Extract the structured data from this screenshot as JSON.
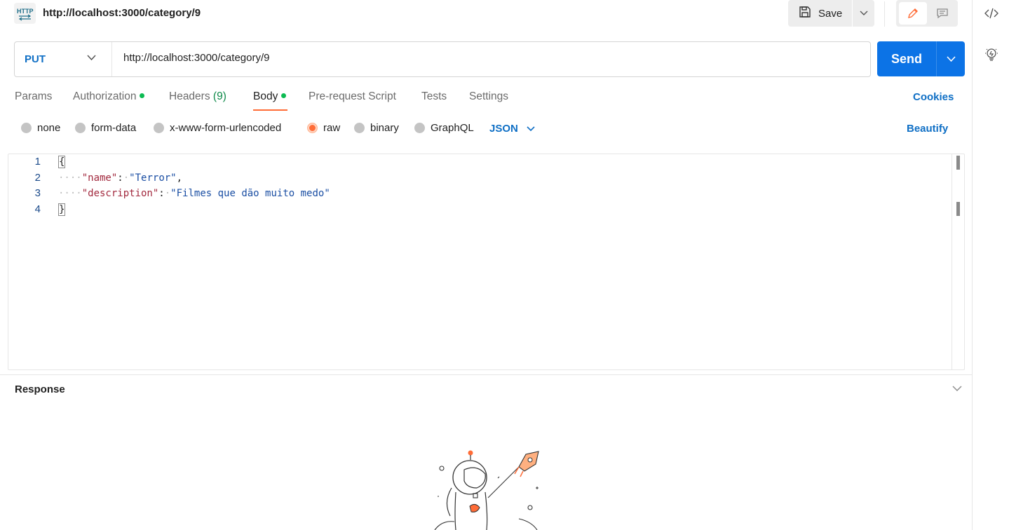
{
  "header": {
    "badge_text": "HTTP",
    "title": "http://localhost:3000/category/9",
    "save_label": "Save"
  },
  "request": {
    "method": "PUT",
    "url": "http://localhost:3000/category/9",
    "send_label": "Send"
  },
  "tabs": [
    {
      "label": "Params"
    },
    {
      "label": "Authorization"
    },
    {
      "label": "Headers",
      "count": "(9)"
    },
    {
      "label": "Body"
    },
    {
      "label": "Pre-request Script"
    },
    {
      "label": "Tests"
    },
    {
      "label": "Settings"
    }
  ],
  "active_tab": "Body",
  "cookies_label": "Cookies",
  "body_types": [
    "none",
    "form-data",
    "x-www-form-urlencoded",
    "raw",
    "binary",
    "GraphQL"
  ],
  "selected_body_type": "raw",
  "format": "JSON",
  "beautify_label": "Beautify",
  "code": {
    "line_numbers": [
      "1",
      "2",
      "3",
      "4"
    ],
    "open_brace": "{",
    "close_brace": "}",
    "key1": "\"name\"",
    "val1": "\"Terror\"",
    "key2": "\"description\"",
    "val2": "\"Filmes que dão muito medo\""
  },
  "response": {
    "title": "Response"
  },
  "colors": {
    "accent": "#ff6c37",
    "primary": "#0c73e6",
    "link": "#0f6fc5",
    "status_dot": "#0cbb52"
  },
  "icons": [
    "http-icon",
    "save-icon",
    "chevron-down-icon",
    "pencil-icon",
    "comment-icon",
    "code-icon",
    "lightbulb-icon",
    "astronaut-illustration"
  ]
}
